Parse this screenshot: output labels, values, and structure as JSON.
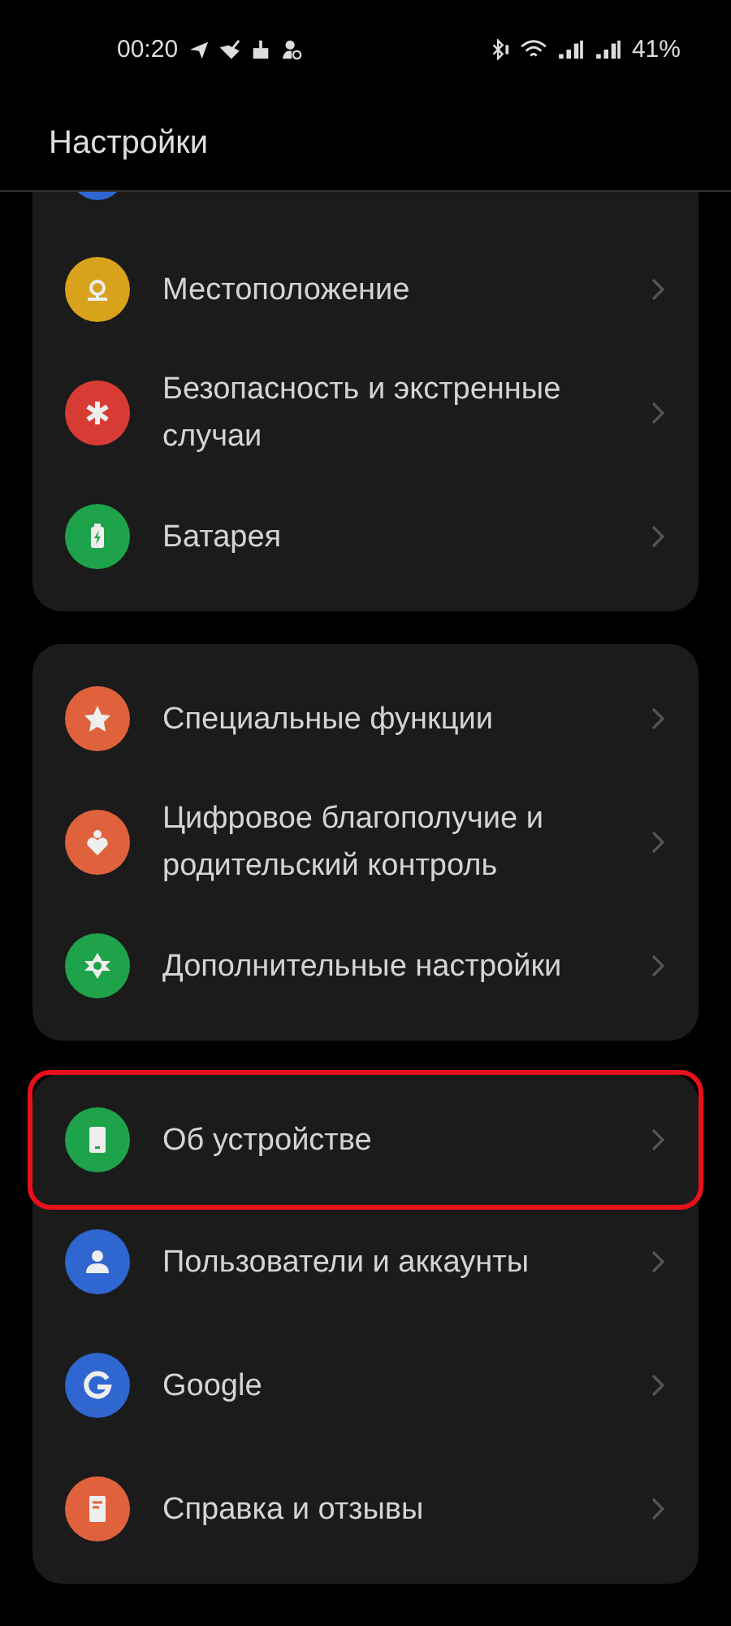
{
  "status_bar": {
    "time": "00:20",
    "battery": "41%"
  },
  "header": {
    "title": "Настройки"
  },
  "cards": [
    {
      "cut_top": true,
      "items": [
        {
          "label": "Местоположение",
          "color": "#d9a21b",
          "highlighted": false
        },
        {
          "label": "Безопасность и экстренные случаи",
          "color": "#d63c33",
          "highlighted": false
        },
        {
          "label": "Батарея",
          "color": "#1fa34a",
          "highlighted": false
        }
      ]
    },
    {
      "cut_top": false,
      "items": [
        {
          "label": "Специальные функции",
          "color": "#e0623c",
          "highlighted": false
        },
        {
          "label": "Цифровое благополучие и родительский контроль",
          "color": "#e0623c",
          "highlighted": false
        },
        {
          "label": "Дополнительные настройки",
          "color": "#1fa34a",
          "highlighted": false
        }
      ]
    },
    {
      "cut_top": false,
      "items": [
        {
          "label": "Об устройстве",
          "color": "#1fa34a",
          "highlighted": true
        },
        {
          "label": "Пользователи и аккаунты",
          "color": "#2f66d0",
          "highlighted": false
        },
        {
          "label": "Google",
          "color": "#2f66d0",
          "highlighted": false
        },
        {
          "label": "Справка и отзывы",
          "color": "#e0623c",
          "highlighted": false
        }
      ]
    }
  ]
}
